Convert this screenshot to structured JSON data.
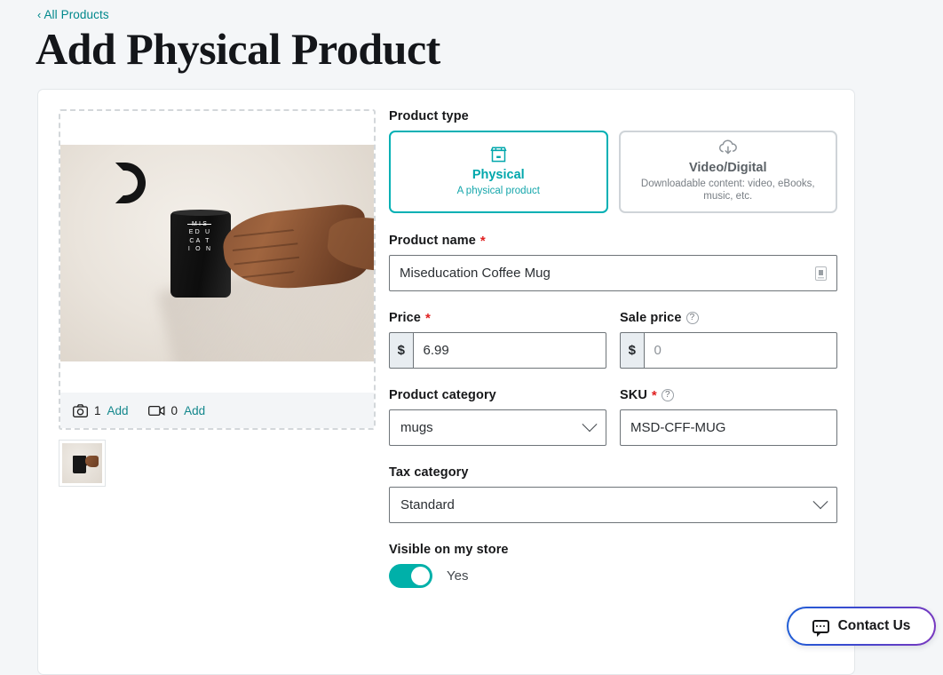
{
  "header": {
    "breadcrumb": "All Products",
    "breadcrumb_chevron": "‹",
    "title": "Add Physical Product"
  },
  "media": {
    "photos": {
      "icon": "camera-icon",
      "count": "1",
      "add_label": "Add"
    },
    "videos": {
      "icon": "video-camera-icon",
      "count": "0",
      "add_label": "Add"
    },
    "mug_text_line1": "MIS",
    "mug_text_col1": [
      "E",
      "C",
      "I"
    ],
    "mug_text_col2": [
      "D",
      "A",
      "O"
    ],
    "mug_text_col3": [
      "U",
      "T",
      "N"
    ]
  },
  "form": {
    "product_type": {
      "label": "Product type",
      "options": [
        {
          "name": "Physical",
          "description": "A physical product",
          "icon": "store-icon",
          "selected": true
        },
        {
          "name": "Video/Digital",
          "description": "Downloadable content: video, eBooks, music, etc.",
          "icon": "cloud-download-icon",
          "selected": false
        }
      ]
    },
    "product_name": {
      "label": "Product name",
      "required": "*",
      "value": "Miseducation Coffee Mug"
    },
    "price": {
      "label": "Price",
      "required": "*",
      "prefix": "$",
      "value": "6.99"
    },
    "sale_price": {
      "label": "Sale price",
      "help": "?",
      "prefix": "$",
      "placeholder": "0"
    },
    "product_category": {
      "label": "Product category",
      "value": "mugs"
    },
    "sku": {
      "label": "SKU",
      "required": "*",
      "help": "?",
      "value": "MSD-CFF-MUG"
    },
    "tax_category": {
      "label": "Tax category",
      "value": "Standard"
    },
    "visible": {
      "label": "Visible on my store",
      "state": "Yes"
    }
  },
  "contact": {
    "label": "Contact Us",
    "icon": "chat-bubble-icon"
  },
  "colors": {
    "accent_teal": "#00b0b4",
    "link_teal": "#13878c",
    "required_red": "#e02020",
    "page_bg": "#f4f6f8",
    "contact_gradient_start": "#1f5fd6",
    "contact_gradient_end": "#7a37bf"
  }
}
